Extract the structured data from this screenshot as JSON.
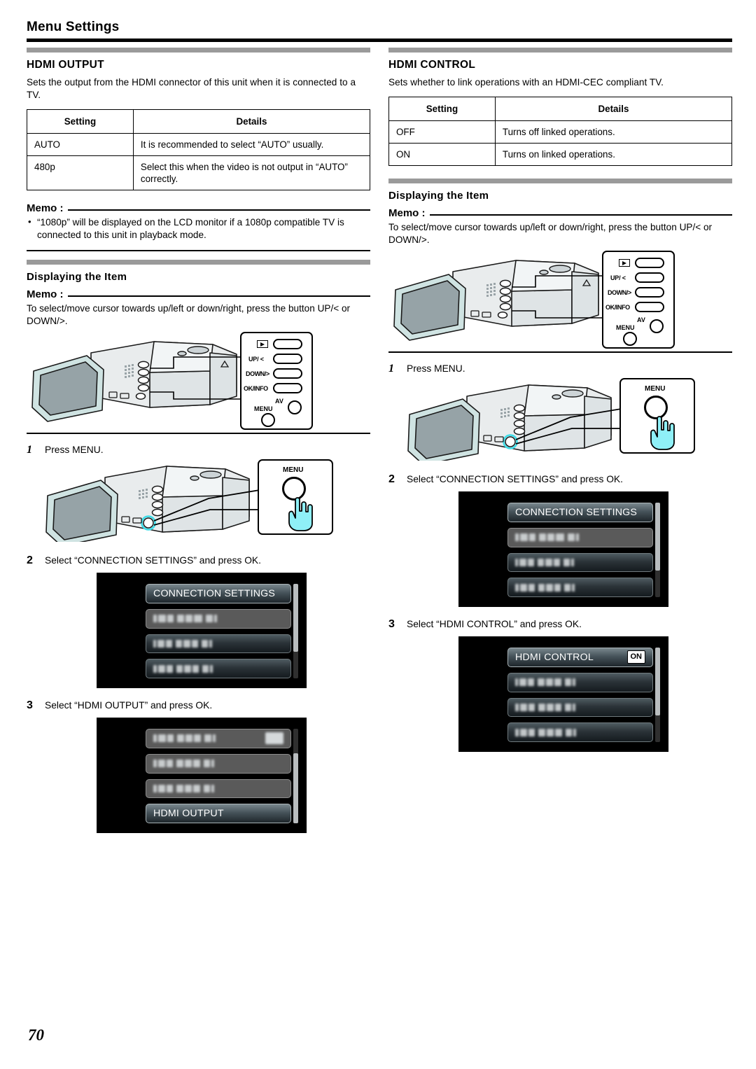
{
  "header": {
    "title": "Menu Settings"
  },
  "page_number": "70",
  "left": {
    "section_title": "HDMI OUTPUT",
    "intro": "Sets the output from the HDMI connector of this unit when it is connected to a TV.",
    "table": {
      "headers": [
        "Setting",
        "Details"
      ],
      "rows": [
        [
          "AUTO",
          "It is recommended to select “AUTO” usually."
        ],
        [
          "480p",
          "Select this when the video is not output in “AUTO” correctly."
        ]
      ]
    },
    "memo_label": "Memo :",
    "memo_items": [
      "“1080p” will be displayed on the LCD monitor if a 1080p compatible TV is connected to this unit in playback mode."
    ],
    "displaying_title": "Displaying the Item",
    "displaying_memo_label": "Memo :",
    "displaying_memo": "To select/move cursor towards up/left or down/right, press the button UP/< or DOWN/>.",
    "button_panel": {
      "playback_icon": "play-icon",
      "up": "UP/ <",
      "down": "DOWN/>",
      "ok": "OK/INFO",
      "av": "AV",
      "menu": "MENU"
    },
    "steps": [
      {
        "num": "1",
        "text": "Press MENU."
      },
      {
        "num": "2",
        "text": "Select “CONNECTION SETTINGS” and press OK."
      },
      {
        "num": "3",
        "text": "Select “HDMI OUTPUT” and press OK."
      }
    ],
    "menu_button_label": "MENU",
    "screen_step2": {
      "rows": [
        {
          "label": "CONNECTION SETTINGS",
          "style": "sel",
          "blurred": false
        },
        {
          "label": "",
          "style": "gray",
          "blurred": true
        },
        {
          "label": "",
          "style": "normal",
          "blurred": true
        },
        {
          "label": "",
          "style": "normal",
          "blurred": true
        }
      ]
    },
    "screen_step3": {
      "rows": [
        {
          "label": "",
          "style": "gray",
          "blurred": true,
          "badge_blur": true
        },
        {
          "label": "",
          "style": "gray",
          "blurred": true
        },
        {
          "label": "",
          "style": "gray",
          "blurred": true
        },
        {
          "label": "HDMI OUTPUT",
          "style": "sel",
          "blurred": false
        }
      ]
    }
  },
  "right": {
    "section_title": "HDMI CONTROL",
    "intro": "Sets whether to link operations with an HDMI-CEC compliant TV.",
    "table": {
      "headers": [
        "Setting",
        "Details"
      ],
      "rows": [
        [
          "OFF",
          "Turns off linked operations."
        ],
        [
          "ON",
          "Turns on linked operations."
        ]
      ]
    },
    "displaying_title": "Displaying the Item",
    "displaying_memo_label": "Memo :",
    "displaying_memo": "To select/move cursor towards up/left or down/right, press the button UP/< or DOWN/>.",
    "button_panel": {
      "playback_icon": "play-icon",
      "up": "UP/ <",
      "down": "DOWN/>",
      "ok": "OK/INFO",
      "av": "AV",
      "menu": "MENU"
    },
    "steps": [
      {
        "num": "1",
        "text": "Press MENU."
      },
      {
        "num": "2",
        "text": "Select “CONNECTION SETTINGS” and press OK."
      },
      {
        "num": "3",
        "text": "Select “HDMI CONTROL” and press OK."
      }
    ],
    "menu_button_label": "MENU",
    "screen_step2": {
      "rows": [
        {
          "label": "CONNECTION SETTINGS",
          "style": "sel",
          "blurred": false
        },
        {
          "label": "",
          "style": "gray",
          "blurred": true
        },
        {
          "label": "",
          "style": "normal",
          "blurred": true
        },
        {
          "label": "",
          "style": "normal",
          "blurred": true
        }
      ]
    },
    "screen_step3": {
      "rows": [
        {
          "label": "HDMI CONTROL",
          "style": "sel",
          "blurred": false,
          "badge": "ON"
        },
        {
          "label": "",
          "style": "normal",
          "blurred": true
        },
        {
          "label": "",
          "style": "normal",
          "blurred": true
        },
        {
          "label": "",
          "style": "normal",
          "blurred": true
        }
      ]
    }
  },
  "colors": {
    "accent_cyan": "#3ddde8",
    "rule_black": "#000000",
    "section_bar_gray": "#9a9a9a",
    "lcd_black": "#000000"
  }
}
